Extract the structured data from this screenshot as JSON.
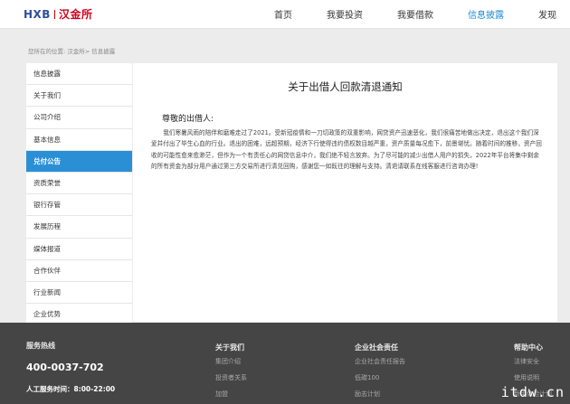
{
  "header": {
    "logo_latin": "HXB",
    "logo_cn": "汉金所",
    "nav": [
      "首页",
      "我要投资",
      "我要借款",
      "信息披露",
      "发现"
    ]
  },
  "breadcrumb": "您所在的位置: 汉金所> 信息披露",
  "sidebar": [
    "信息披露",
    "关于我们",
    "公司介绍",
    "基本信息",
    "兑付公告",
    "资质荣誉",
    "银行存管",
    "发展历程",
    "媒体报道",
    "合作伙伴",
    "行业新闻",
    "企业优势"
  ],
  "article": {
    "title": "关于出借人回款清退通知",
    "greeting": "尊敬的出借人:",
    "body": "我们寒暑风雨的陪伴和磨难走过了2021。受新冠疫情和一刀切政策的双重影响，网贷资产迅速恶化，我们很痛苦地做出决定，退出这个我们深爱并付出了毕生心血的行业。退出的困难，远超预期，经济下行使得违约债权数目越严重，资产质量每况愈下，前景堪忧。随着时间的推移，资产回收的可能性愈来愈渺茫，但作为一个有责任心的网贷信息中介，我们绝不轻言放弃。为了尽可能的减少出借人用户的损失，2022年平台将集中剩余的所有资金为部分用户通过第三方交易所进行清兑回购，感谢您一如既往的理解与支持。清退请联系在线客服进行咨询办理!"
  },
  "footer": {
    "service_heading": "服务热线",
    "phone": "400-0037-702",
    "hours": "人工服务时间：8:00-22:00",
    "about_heading": "关于我们",
    "about_links": [
      "集团介绍",
      "投资者关系",
      "加盟"
    ],
    "csr_heading": "企业社会责任",
    "csr_links": [
      "企业社会责任报告",
      "低碳100",
      "励志计划"
    ],
    "help_heading": "帮助中心",
    "help_links": [
      "法律安全",
      "使用说明",
      "新手体验计划"
    ]
  },
  "watermark": "itdw.cn"
}
